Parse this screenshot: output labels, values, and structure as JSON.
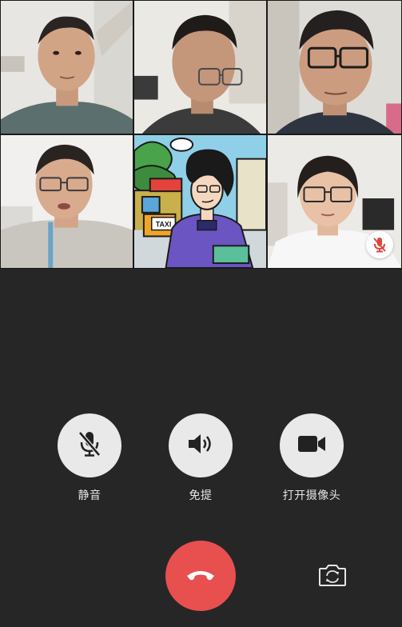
{
  "participants": [
    {
      "id": "p1",
      "icon": "person-video",
      "muted": false
    },
    {
      "id": "p2",
      "icon": "person-video",
      "muted": false
    },
    {
      "id": "p3",
      "icon": "person-video",
      "muted": false
    },
    {
      "id": "p4",
      "icon": "person-video",
      "muted": false
    },
    {
      "id": "p5",
      "icon": "cartoon-avatar",
      "avatar_text": "TAXI",
      "muted": false
    },
    {
      "id": "p6",
      "icon": "person-video",
      "muted": true
    }
  ],
  "controls": {
    "mute_label": "静音",
    "speaker_label": "免提",
    "camera_label": "打开摄像头",
    "mute_icon": "mic-off-icon",
    "speaker_icon": "speaker-icon",
    "camera_icon": "video-camera-icon"
  },
  "actions": {
    "hangup_icon": "hangup-icon",
    "switch_camera_icon": "switch-camera-icon"
  },
  "colors": {
    "background": "#262626",
    "control_button": "#e9e9e9",
    "hangup": "#e84f4f",
    "mute_badge_icon": "#e0443c"
  }
}
